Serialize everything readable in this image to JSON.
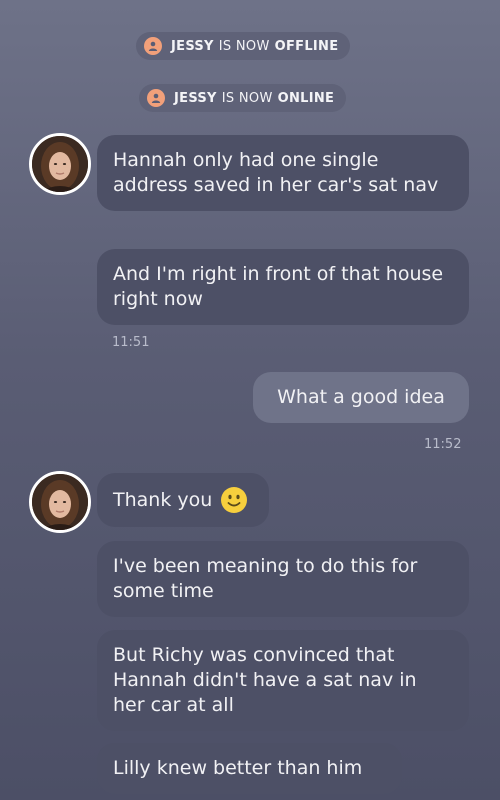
{
  "status": [
    {
      "name": "JESSY",
      "middle": "IS NOW",
      "state": "OFFLINE"
    },
    {
      "name": "JESSY",
      "middle": "IS NOW",
      "state": "ONLINE"
    }
  ],
  "messages": {
    "m1": "Hannah only had one single address saved in her car's sat nav",
    "m2": "And I'm right in front of that house right now",
    "t1": "11:51",
    "m3": "What a good idea",
    "t2": "11:52",
    "m4": "Thank you",
    "m5": "I've been meaning to do this for some time",
    "m6": "But Richy was convinced that Hannah didn't have a sat nav in her car at all",
    "m7": "Lilly knew better than him"
  },
  "colors": {
    "status_dot": "#f2a07a",
    "incoming_bubble": "#4d5066",
    "outgoing_bubble": "#6f7389"
  }
}
